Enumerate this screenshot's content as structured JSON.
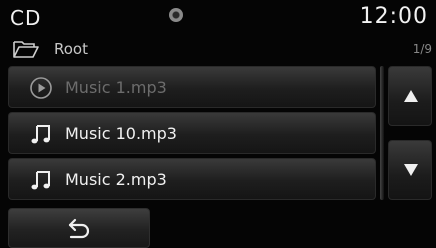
{
  "status": {
    "source": "CD",
    "time": "12:00"
  },
  "folder": {
    "name": "Root",
    "track_count": "1/9"
  },
  "tracks": [
    {
      "name": "Music 1.mp3",
      "icon": "play-circle-icon",
      "state": "playing-dimmed"
    },
    {
      "name": "Music 10.mp3",
      "icon": "music-note-icon",
      "state": "normal"
    },
    {
      "name": "Music 2.mp3",
      "icon": "music-note-icon",
      "state": "normal"
    }
  ],
  "controls": {
    "scroll_up": "up-arrow-icon",
    "scroll_down": "down-arrow-icon",
    "back": "back-arrow-icon"
  },
  "colors": {
    "background": "#050505",
    "text": "#f0f0f0",
    "dimmed_text": "#6c6c6c"
  }
}
